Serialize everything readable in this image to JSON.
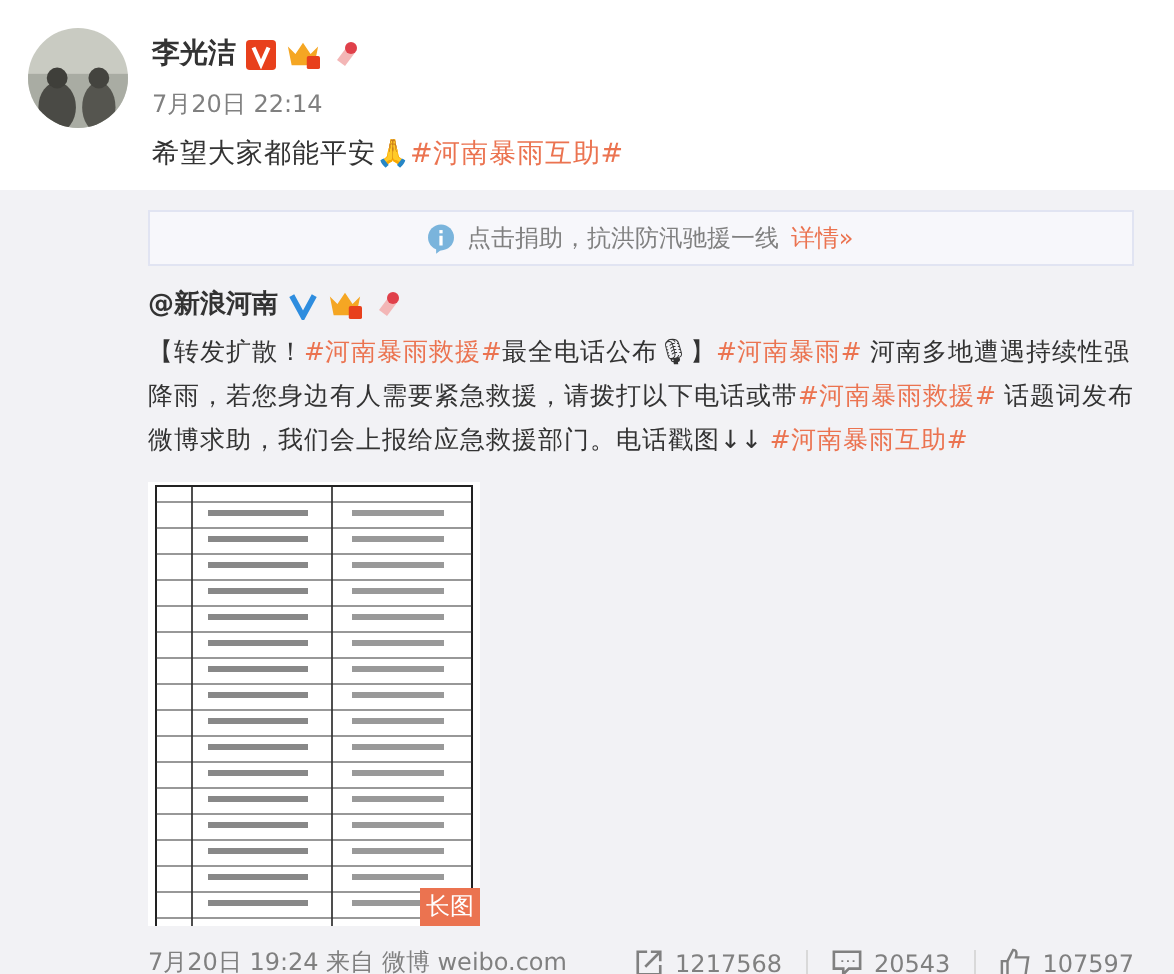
{
  "author": {
    "name": "李光洁",
    "time": "7月20日 22:14"
  },
  "post": {
    "segments": [
      {
        "kind": "plain",
        "text": "希望大家都能平安"
      },
      {
        "kind": "emoji",
        "text": "🙏"
      },
      {
        "kind": "topic",
        "text": "#河南暴雨互助#"
      }
    ]
  },
  "notice": {
    "text": "点击捐助，抗洪防汛驰援一线",
    "link": "详情»"
  },
  "repost": {
    "author": "@新浪河南",
    "segments": [
      {
        "kind": "plain",
        "text": "【转发扩散！"
      },
      {
        "kind": "topic",
        "text": "#河南暴雨救援#"
      },
      {
        "kind": "plain",
        "text": "最全电话公布"
      },
      {
        "kind": "emoji",
        "text": "🎙"
      },
      {
        "kind": "plain",
        "text": "】"
      },
      {
        "kind": "topic",
        "text": "#河南暴雨#"
      },
      {
        "kind": "plain",
        "text": " 河南多地遭遇持续性强降雨，若您身边有人需要紧急救援，请拨打以下电话或带"
      },
      {
        "kind": "topic",
        "text": "#河南暴雨救援#"
      },
      {
        "kind": "plain",
        "text": " 话题词发布微博求助，我们会上报给应急救援部门。电话戳图↓↓ "
      },
      {
        "kind": "topic",
        "text": "#河南暴雨互助#"
      }
    ],
    "image": {
      "kind": "picture",
      "badge": "长图"
    },
    "time": "7月20日 19:24 来自 微博 weibo.com",
    "stats": [
      {
        "kind": "repost",
        "count": "1217568"
      },
      {
        "kind": "comment",
        "count": "20543"
      },
      {
        "kind": "like",
        "count": "107597"
      }
    ]
  }
}
